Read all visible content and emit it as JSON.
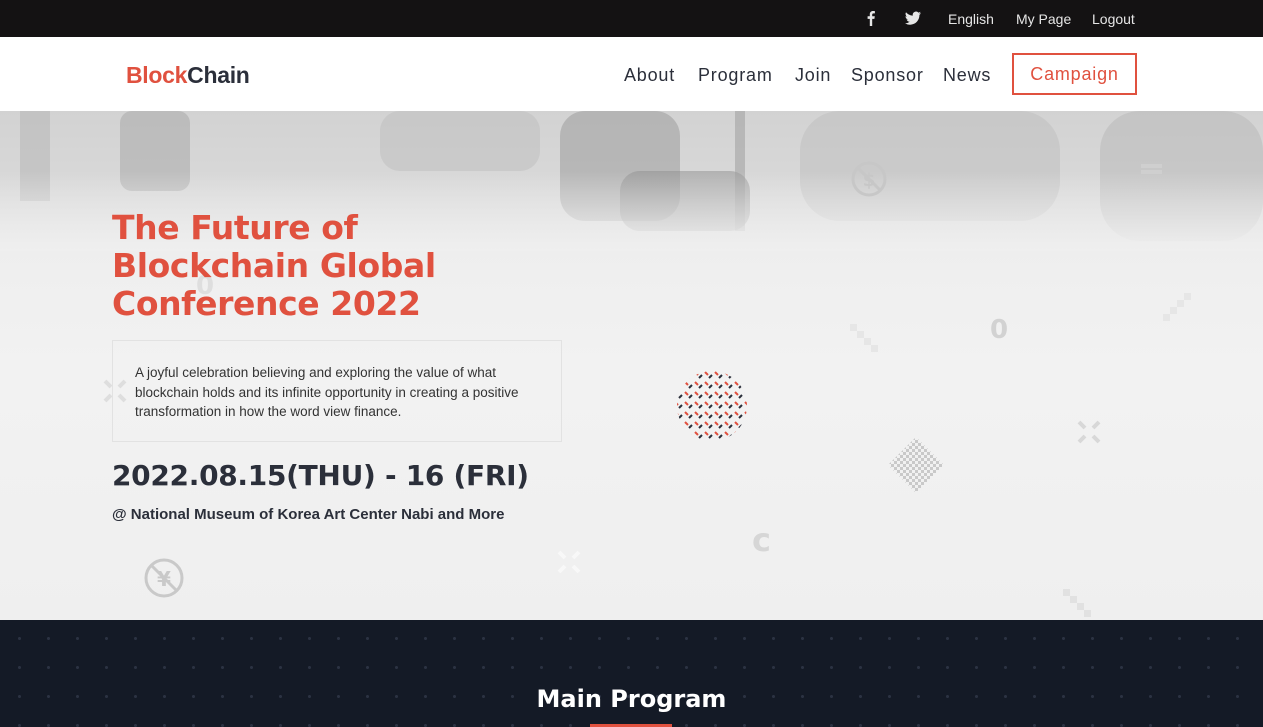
{
  "topbar": {
    "social": [
      {
        "icon": "facebook-icon"
      },
      {
        "icon": "twitter-icon"
      }
    ],
    "links": [
      "English",
      "My Page",
      "Logout"
    ]
  },
  "header": {
    "logo_part1": "Block",
    "logo_part2": "Chain",
    "nav": [
      "About",
      "Program",
      "Join",
      "Sponsor",
      "News"
    ],
    "campaign_label": "Campaign"
  },
  "hero": {
    "title": "The Future of Blockchain Global Conference 2022",
    "description": "A joyful celebration believing and exploring the value of what blockchain holds and its infinite opportunity in creating a positive transformation in how the word view finance.",
    "date": "2022.08.15(THU) - 16 (FRI)",
    "venue": "@ National Museum of Korea Art Center Nabi and More",
    "decor_glyphs": [
      "0",
      "0",
      "c"
    ]
  },
  "program": {
    "title": "Main Program"
  },
  "colors": {
    "accent": "#e0513f",
    "dark_text": "#2b2f3a",
    "topbar_bg": "#141213",
    "program_bg": "#141a26"
  }
}
